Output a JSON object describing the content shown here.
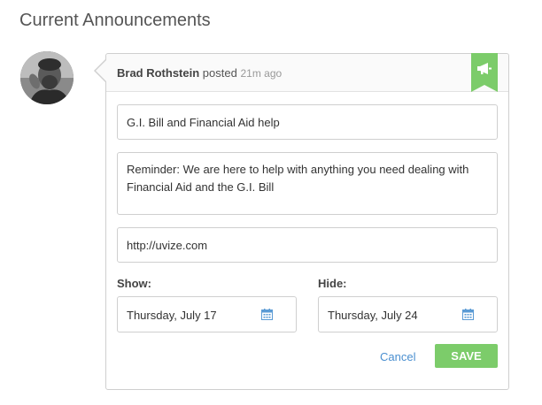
{
  "page": {
    "title": "Current Announcements"
  },
  "announcement": {
    "author": "Brad Rothstein",
    "verb": "posted",
    "time_ago": "21m ago",
    "title_value": "G.I. Bill and Financial Aid help",
    "body_value": "Reminder:  We are here to help with anything you need dealing with Financial Aid and the G.I. Bill",
    "url_value": "http://uvize.com",
    "show_label": "Show:",
    "show_date": "Thursday, July 17",
    "hide_label": "Hide:",
    "hide_date": "Thursday, July 24",
    "cancel_label": "Cancel",
    "save_label": "SAVE"
  },
  "icons": {
    "badge": "megaphone-icon",
    "date_picker": "calendar-icon"
  },
  "colors": {
    "accent_green": "#7ccc6a",
    "link_blue": "#4a8fd0",
    "calendar_blue": "#5b9bd5"
  }
}
